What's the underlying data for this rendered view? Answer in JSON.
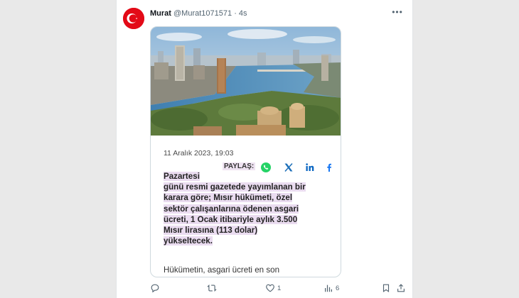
{
  "tweet": {
    "author_name": "Murat",
    "author_handle": "@Murat1071571",
    "timestamp": "· 4s",
    "avatar": "turkish-flag-avatar",
    "more_icon": "more-horizontal-icon"
  },
  "card": {
    "image": "cairo-nile-skyline-photo",
    "date": "11 Aralık 2023, 19:03",
    "share_label": "PAYLAŞ:",
    "share_icons": [
      "whatsapp-icon",
      "x-icon",
      "linkedin-icon",
      "facebook-icon"
    ],
    "headline_lines": [
      "Pazartesi",
      "günü resmi gazetede yayımlanan bir",
      "karara göre; Mısır hükümeti, özel",
      "sektör çalışanlarına ödenen asgari",
      "ücreti, 1 Ocak itibariyle aylık 3.500",
      "Mısır lirasına (113 dolar)",
      "yükseltecek."
    ],
    "continuation": "Hükümetin, asgari ücreti en son"
  },
  "actions": {
    "reply_count": "",
    "retweet_count": "",
    "like_count": "1",
    "views_count": "6"
  },
  "colors": {
    "highlight": "#eadcf0",
    "avatar_red": "#e30a17",
    "muted": "#536471"
  }
}
